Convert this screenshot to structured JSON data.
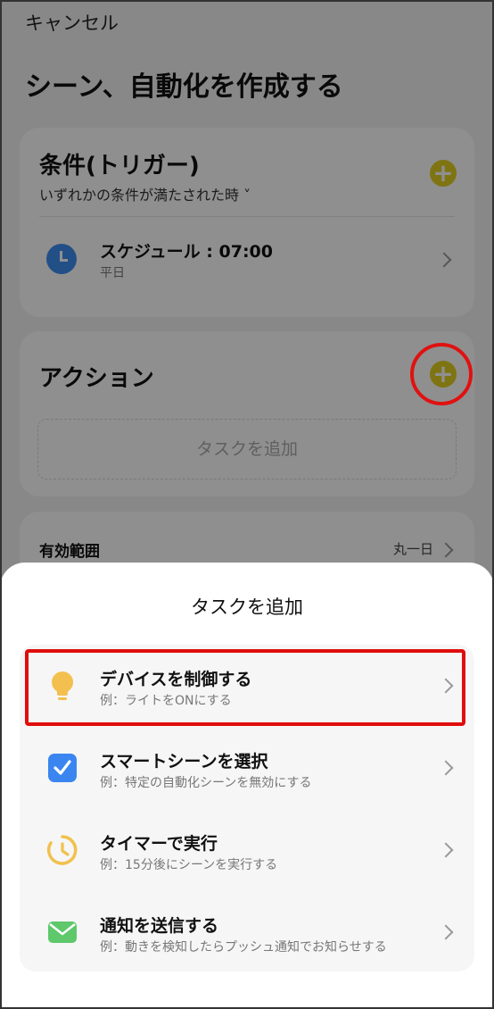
{
  "header": {
    "cancel": "キャンセル",
    "title": "シーン、自動化を作成する"
  },
  "condition": {
    "title": "条件(トリガー)",
    "subtitle": "いずれかの条件が満たされた時 ˅",
    "schedule_title": "スケジュール : 07:00",
    "schedule_sub": "平日"
  },
  "action": {
    "title": "アクション",
    "add_task": "タスクを追加"
  },
  "scope": {
    "label": "有効範囲",
    "value": "丸一日"
  },
  "sheet": {
    "title": "タスクを追加",
    "items": [
      {
        "title": "デバイスを制御する",
        "sub": "例：ライトをONにする",
        "icon": "bulb-icon"
      },
      {
        "title": "スマートシーンを選択",
        "sub": "例：特定の自動化シーンを無効にする",
        "icon": "checkbox-icon"
      },
      {
        "title": "タイマーで実行",
        "sub": "例：15分後にシーンを実行する",
        "icon": "timer-icon"
      },
      {
        "title": "通知を送信する",
        "sub": "例：動きを検知したらプッシュ通知でお知らせする",
        "icon": "mail-icon"
      }
    ]
  },
  "colors": {
    "accent": "#e2cf21",
    "highlight": "#e00d0d",
    "clock": "#3f8ef0"
  }
}
